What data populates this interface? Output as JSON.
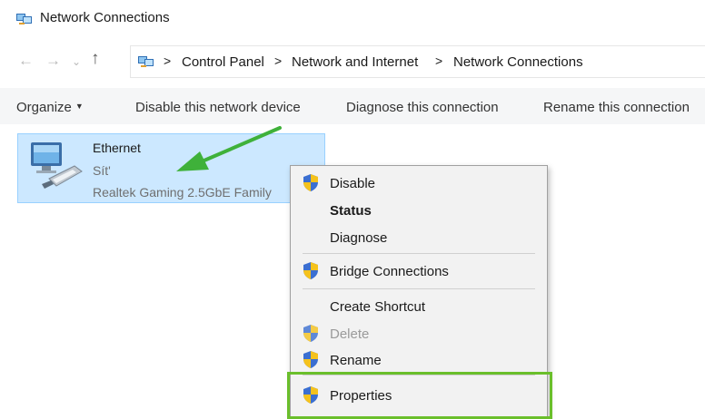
{
  "window": {
    "title": "Network Connections",
    "title_icon": "network-connections-icon"
  },
  "navigation": {
    "back": "←",
    "forward": "→",
    "recent": "⌄",
    "up": "↑",
    "separator": ">",
    "breadcrumbs": [
      "Control Panel",
      "Network and Internet",
      "Network Connections"
    ]
  },
  "toolbar": {
    "organize": "Organize",
    "organize_caret": "▼",
    "disable": "Disable this network device",
    "diagnose": "Diagnose this connection",
    "rename": "Rename this connection"
  },
  "connection": {
    "name": "Ethernet",
    "status": "Sít'",
    "adapter": "Realtek Gaming 2.5GbE Family",
    "icon": "ethernet-adapter-icon"
  },
  "context_menu": {
    "items": [
      {
        "label": "Disable",
        "icon": "uac-shield-icon",
        "style": "normal"
      },
      {
        "label": "Status",
        "icon": "",
        "style": "bold"
      },
      {
        "label": "Diagnose",
        "icon": "",
        "style": "normal"
      },
      {
        "label": "Bridge Connections",
        "icon": "uac-shield-icon",
        "style": "normal"
      },
      {
        "label": "Create Shortcut",
        "icon": "",
        "style": "normal"
      },
      {
        "label": "Delete",
        "icon": "uac-shield-icon",
        "style": "disabled"
      },
      {
        "label": "Rename",
        "icon": "uac-shield-icon",
        "style": "normal"
      },
      {
        "label": "Properties",
        "icon": "uac-shield-icon",
        "style": "normal"
      }
    ]
  },
  "annotations": {
    "arrow_color": "#3fb13a",
    "highlight_color": "#6abf2b"
  },
  "colors": {
    "selection_fill": "#cce8ff",
    "selection_border": "#99d1ff",
    "menu_background": "#f2f2f2"
  }
}
